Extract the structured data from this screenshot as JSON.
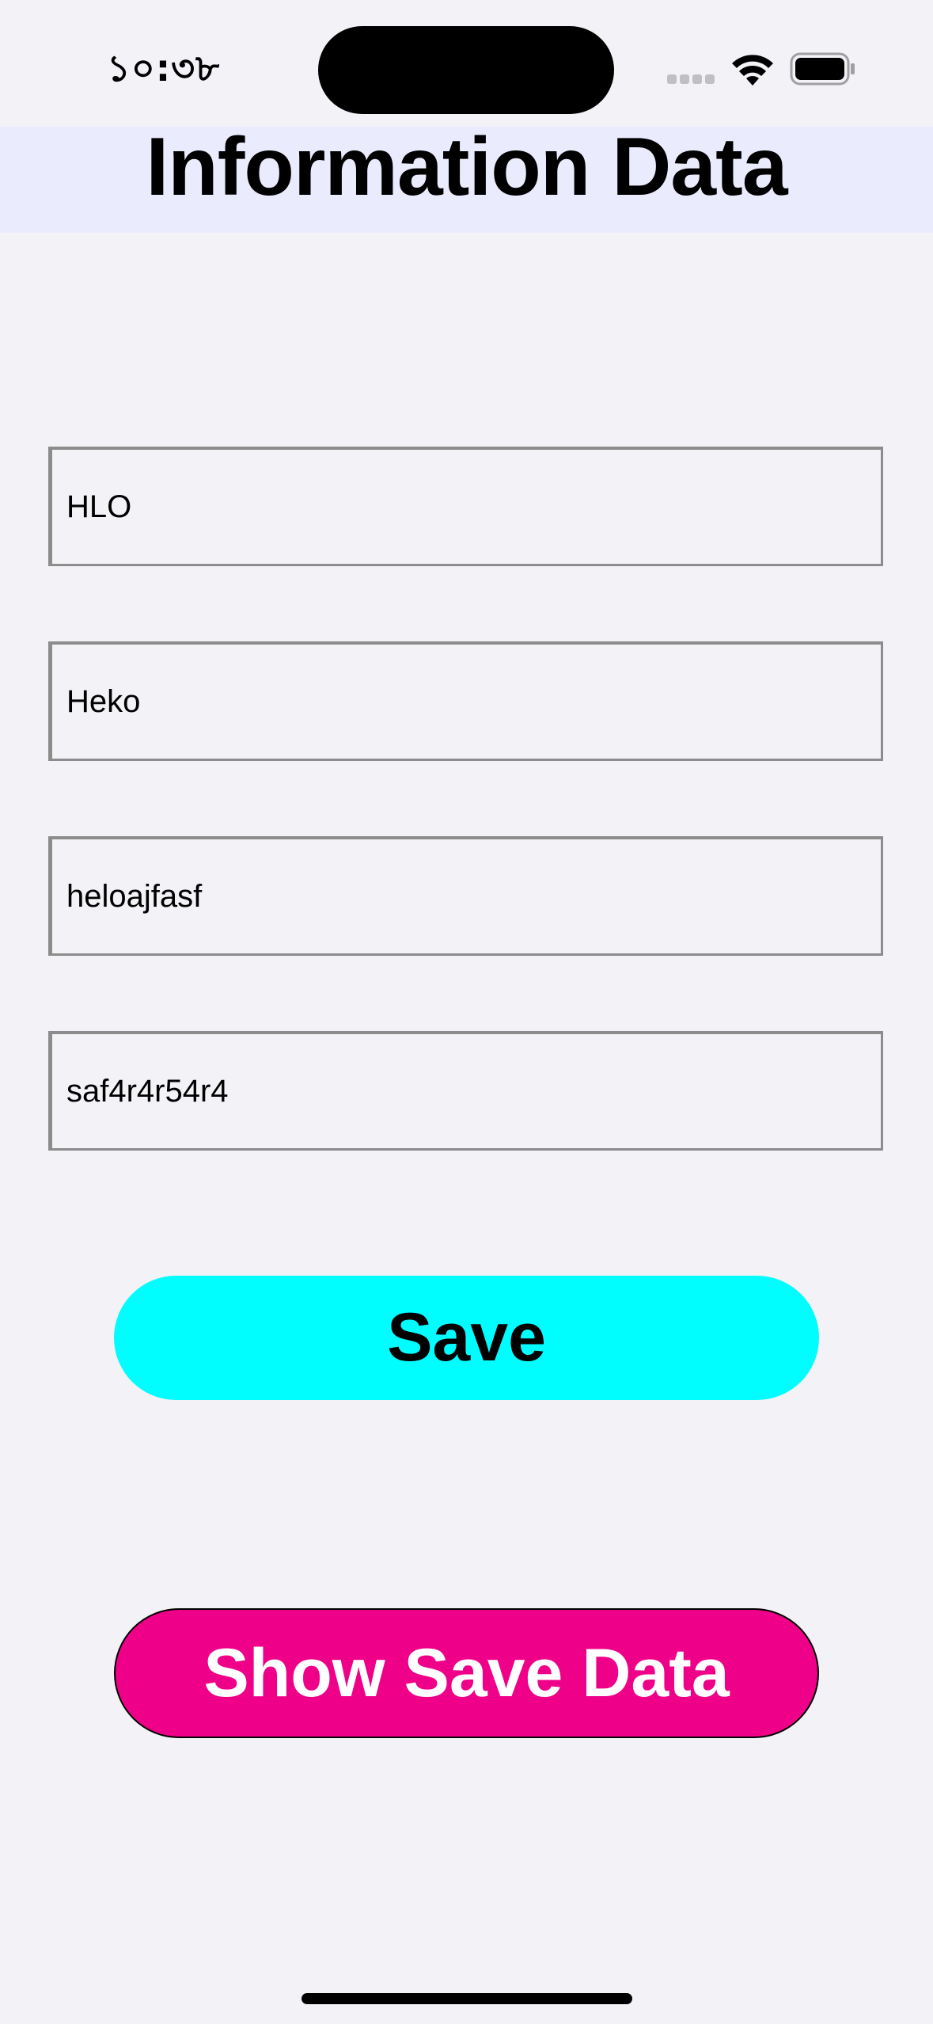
{
  "status_bar": {
    "time": "১০:৩৮",
    "icons": [
      "cellular-signal-icon",
      "wifi-icon",
      "battery-icon"
    ]
  },
  "header": {
    "title": "Information Data",
    "band_color": "#ebebfe"
  },
  "form": {
    "fields": [
      {
        "value": "HLO"
      },
      {
        "value": "Heko"
      },
      {
        "value": "heloajfasf"
      },
      {
        "value": "saf4r4r54r4"
      }
    ]
  },
  "buttons": {
    "save_label": "Save",
    "save_color": "#00fdff",
    "show_label": "Show Save Data",
    "show_color": "#ef0088"
  }
}
